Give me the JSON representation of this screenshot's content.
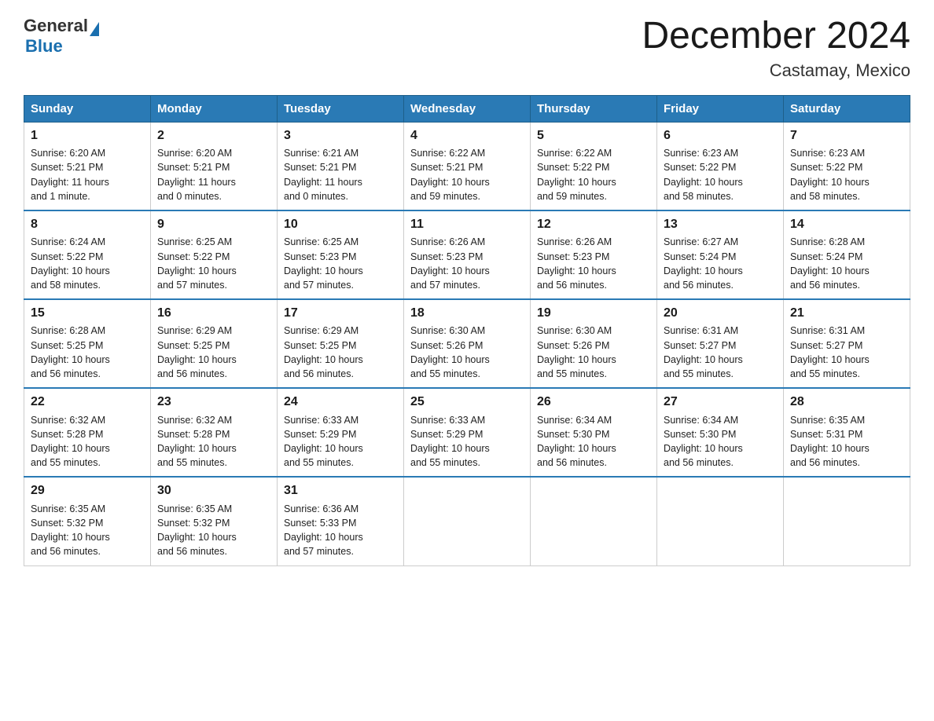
{
  "header": {
    "logo_general": "General",
    "logo_blue": "Blue",
    "title": "December 2024",
    "subtitle": "Castamay, Mexico"
  },
  "days_of_week": [
    "Sunday",
    "Monday",
    "Tuesday",
    "Wednesday",
    "Thursday",
    "Friday",
    "Saturday"
  ],
  "weeks": [
    [
      {
        "day": "1",
        "sunrise": "6:20 AM",
        "sunset": "5:21 PM",
        "daylight": "11 hours and 1 minute."
      },
      {
        "day": "2",
        "sunrise": "6:20 AM",
        "sunset": "5:21 PM",
        "daylight": "11 hours and 0 minutes."
      },
      {
        "day": "3",
        "sunrise": "6:21 AM",
        "sunset": "5:21 PM",
        "daylight": "11 hours and 0 minutes."
      },
      {
        "day": "4",
        "sunrise": "6:22 AM",
        "sunset": "5:21 PM",
        "daylight": "10 hours and 59 minutes."
      },
      {
        "day": "5",
        "sunrise": "6:22 AM",
        "sunset": "5:22 PM",
        "daylight": "10 hours and 59 minutes."
      },
      {
        "day": "6",
        "sunrise": "6:23 AM",
        "sunset": "5:22 PM",
        "daylight": "10 hours and 58 minutes."
      },
      {
        "day": "7",
        "sunrise": "6:23 AM",
        "sunset": "5:22 PM",
        "daylight": "10 hours and 58 minutes."
      }
    ],
    [
      {
        "day": "8",
        "sunrise": "6:24 AM",
        "sunset": "5:22 PM",
        "daylight": "10 hours and 58 minutes."
      },
      {
        "day": "9",
        "sunrise": "6:25 AM",
        "sunset": "5:22 PM",
        "daylight": "10 hours and 57 minutes."
      },
      {
        "day": "10",
        "sunrise": "6:25 AM",
        "sunset": "5:23 PM",
        "daylight": "10 hours and 57 minutes."
      },
      {
        "day": "11",
        "sunrise": "6:26 AM",
        "sunset": "5:23 PM",
        "daylight": "10 hours and 57 minutes."
      },
      {
        "day": "12",
        "sunrise": "6:26 AM",
        "sunset": "5:23 PM",
        "daylight": "10 hours and 56 minutes."
      },
      {
        "day": "13",
        "sunrise": "6:27 AM",
        "sunset": "5:24 PM",
        "daylight": "10 hours and 56 minutes."
      },
      {
        "day": "14",
        "sunrise": "6:28 AM",
        "sunset": "5:24 PM",
        "daylight": "10 hours and 56 minutes."
      }
    ],
    [
      {
        "day": "15",
        "sunrise": "6:28 AM",
        "sunset": "5:25 PM",
        "daylight": "10 hours and 56 minutes."
      },
      {
        "day": "16",
        "sunrise": "6:29 AM",
        "sunset": "5:25 PM",
        "daylight": "10 hours and 56 minutes."
      },
      {
        "day": "17",
        "sunrise": "6:29 AM",
        "sunset": "5:25 PM",
        "daylight": "10 hours and 56 minutes."
      },
      {
        "day": "18",
        "sunrise": "6:30 AM",
        "sunset": "5:26 PM",
        "daylight": "10 hours and 55 minutes."
      },
      {
        "day": "19",
        "sunrise": "6:30 AM",
        "sunset": "5:26 PM",
        "daylight": "10 hours and 55 minutes."
      },
      {
        "day": "20",
        "sunrise": "6:31 AM",
        "sunset": "5:27 PM",
        "daylight": "10 hours and 55 minutes."
      },
      {
        "day": "21",
        "sunrise": "6:31 AM",
        "sunset": "5:27 PM",
        "daylight": "10 hours and 55 minutes."
      }
    ],
    [
      {
        "day": "22",
        "sunrise": "6:32 AM",
        "sunset": "5:28 PM",
        "daylight": "10 hours and 55 minutes."
      },
      {
        "day": "23",
        "sunrise": "6:32 AM",
        "sunset": "5:28 PM",
        "daylight": "10 hours and 55 minutes."
      },
      {
        "day": "24",
        "sunrise": "6:33 AM",
        "sunset": "5:29 PM",
        "daylight": "10 hours and 55 minutes."
      },
      {
        "day": "25",
        "sunrise": "6:33 AM",
        "sunset": "5:29 PM",
        "daylight": "10 hours and 55 minutes."
      },
      {
        "day": "26",
        "sunrise": "6:34 AM",
        "sunset": "5:30 PM",
        "daylight": "10 hours and 56 minutes."
      },
      {
        "day": "27",
        "sunrise": "6:34 AM",
        "sunset": "5:30 PM",
        "daylight": "10 hours and 56 minutes."
      },
      {
        "day": "28",
        "sunrise": "6:35 AM",
        "sunset": "5:31 PM",
        "daylight": "10 hours and 56 minutes."
      }
    ],
    [
      {
        "day": "29",
        "sunrise": "6:35 AM",
        "sunset": "5:32 PM",
        "daylight": "10 hours and 56 minutes."
      },
      {
        "day": "30",
        "sunrise": "6:35 AM",
        "sunset": "5:32 PM",
        "daylight": "10 hours and 56 minutes."
      },
      {
        "day": "31",
        "sunrise": "6:36 AM",
        "sunset": "5:33 PM",
        "daylight": "10 hours and 57 minutes."
      },
      null,
      null,
      null,
      null
    ]
  ],
  "labels": {
    "sunrise": "Sunrise:",
    "sunset": "Sunset:",
    "daylight": "Daylight:"
  }
}
